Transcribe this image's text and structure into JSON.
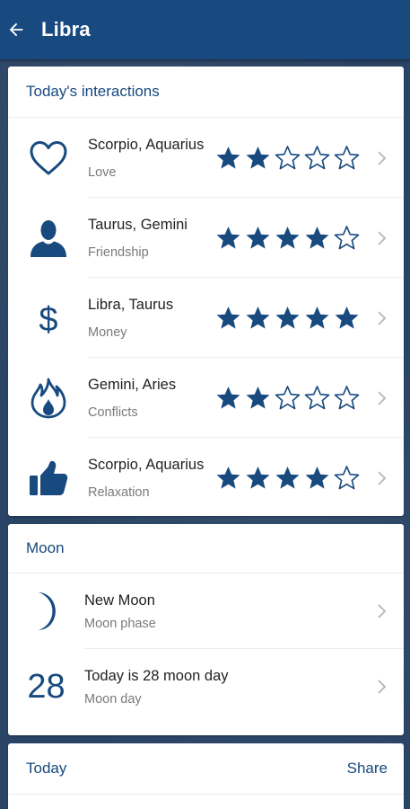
{
  "appbar": {
    "title": "Libra",
    "back_icon": "arrow-left-icon"
  },
  "interactions": {
    "header": "Today's interactions",
    "rows": [
      {
        "icon": "heart-icon",
        "signs": "Scorpio, Aquarius",
        "category": "Love",
        "rating": 2
      },
      {
        "icon": "person-icon",
        "signs": "Taurus, Gemini",
        "category": "Friendship",
        "rating": 4
      },
      {
        "icon": "dollar-icon",
        "signs": "Libra, Taurus",
        "category": "Money",
        "rating": 5
      },
      {
        "icon": "flame-icon",
        "signs": "Gemini, Aries",
        "category": "Conflicts",
        "rating": 2
      },
      {
        "icon": "thumbs-up-icon",
        "signs": "Scorpio, Aquarius",
        "category": "Relaxation",
        "rating": 4
      }
    ],
    "max_rating": 5
  },
  "moon": {
    "header": "Moon",
    "phase_title": "New Moon",
    "phase_sub": "Moon phase",
    "day_number": "28",
    "day_title": "Today is 28 moon day",
    "day_sub": "Moon day"
  },
  "today": {
    "header": "Today",
    "share_label": "Share"
  },
  "colors": {
    "accent": "#18497f",
    "background": "#2a4466",
    "muted": "#7a7a7a"
  }
}
